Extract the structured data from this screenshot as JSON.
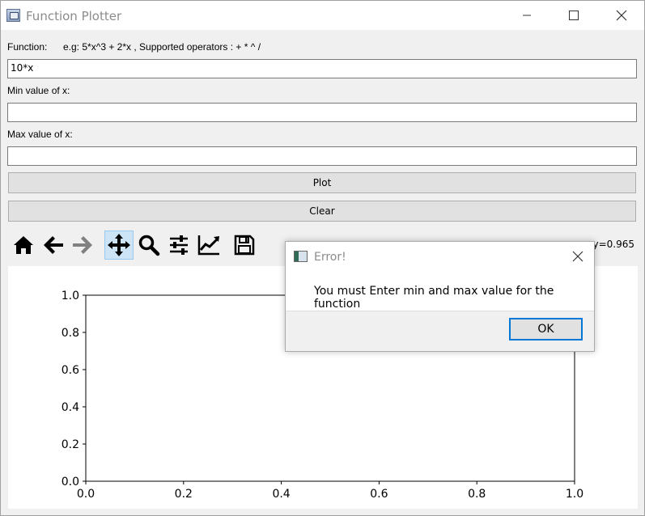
{
  "window": {
    "title": "Function Plotter"
  },
  "form": {
    "function_label": "Function:",
    "function_hint": "e.g: 5*x^3 + 2*x  ,  Supported operators :   + * ^ /",
    "function_value": "10*x",
    "min_label": "Min value of x:",
    "min_value": "",
    "max_label": "Max value of x:",
    "max_value": ""
  },
  "buttons": {
    "plot": "Plot",
    "clear": "Clear"
  },
  "toolbar": {
    "items": [
      "home-icon",
      "back-arrow-icon",
      "forward-arrow-icon",
      "pan-icon",
      "zoom-icon",
      "configure-subplots-icon",
      "edit-axis-icon",
      "save-icon"
    ],
    "active": "pan-icon",
    "coords_readout": "y=0.965"
  },
  "chart_data": {
    "type": "line",
    "series": [],
    "xlim": [
      0.0,
      1.0
    ],
    "ylim": [
      0.0,
      1.0
    ],
    "xticks": [
      "0.0",
      "0.2",
      "0.4",
      "0.6",
      "0.8",
      "1.0"
    ],
    "yticks": [
      "0.0",
      "0.2",
      "0.4",
      "0.6",
      "0.8",
      "1.0"
    ],
    "title": "",
    "xlabel": "",
    "ylabel": "",
    "grid": false
  },
  "dialog": {
    "title": "Error!",
    "message": "You must Enter min and max value for the function",
    "ok_label": "OK"
  },
  "colors": {
    "accent": "#0078d7",
    "active_tool_bg": "#cde4f7"
  }
}
